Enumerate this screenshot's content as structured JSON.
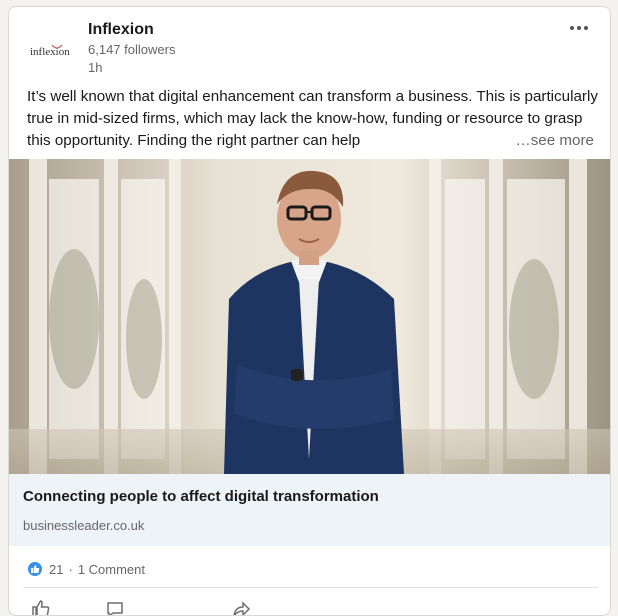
{
  "post": {
    "company": {
      "name": "Inflexion",
      "logo_text": "inflexion",
      "followers": "6,147 followers",
      "time": "1h"
    },
    "menu_icon": "ellipsis-icon",
    "text": "It’s well known that digital enhancement can transform a business. This is particularly true in mid-sized firms, which may lack the know-how, funding or resource to grasp this opportunity. Finding the right partner can help",
    "see_more": "…see more",
    "image_icon": "portrait-photo",
    "link": {
      "title": "Connecting people to affect digital transformation",
      "domain": "businessleader.co.uk"
    },
    "social": {
      "reaction_icon": "like-icon",
      "reactions": "21",
      "separator": "·",
      "comments": "1 Comment"
    },
    "actions": [
      {
        "icon": "like-icon"
      },
      {
        "icon": "comment-icon"
      },
      {
        "icon": "share-icon"
      }
    ]
  },
  "colors": {
    "accent": "#378fe9",
    "link_bg": "#eef3f8",
    "text": "#191919",
    "muted": "#666666"
  }
}
